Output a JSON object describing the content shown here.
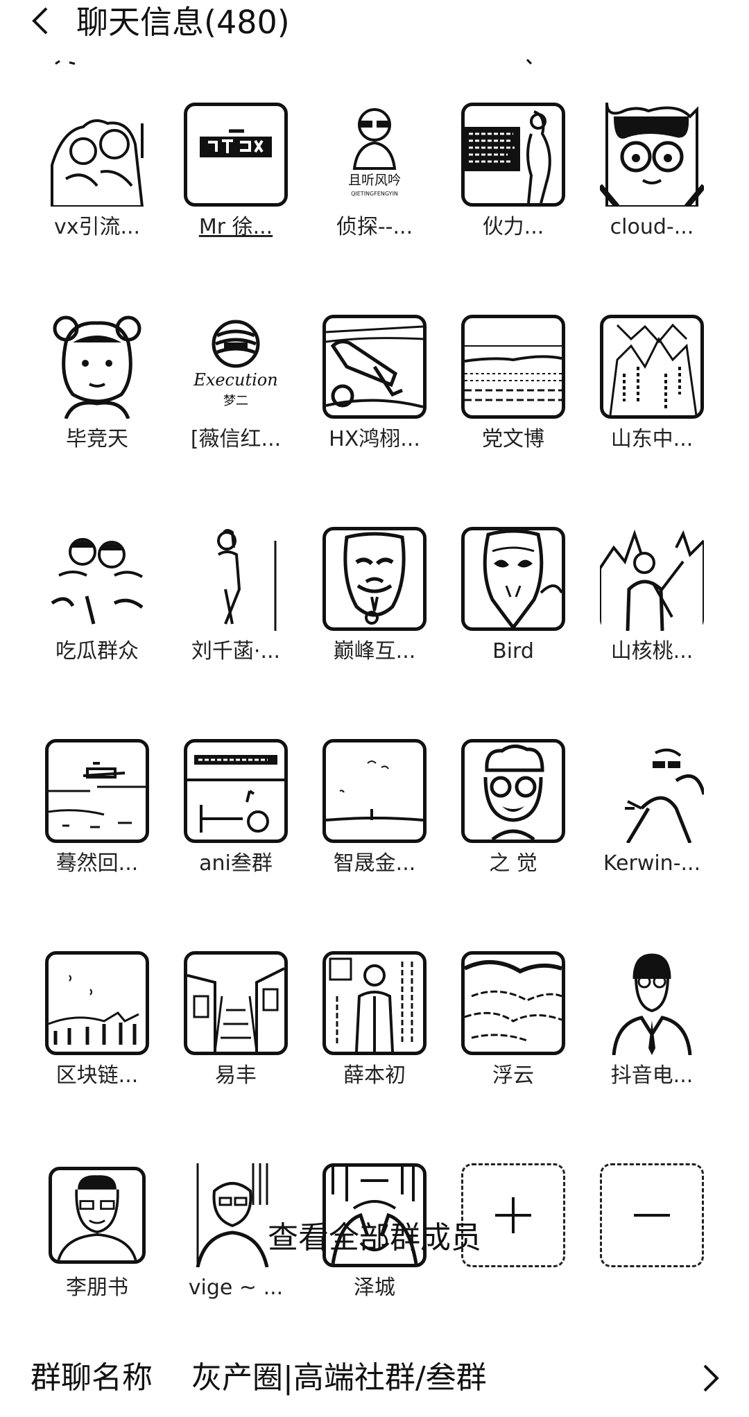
{
  "header": {
    "title": "聊天信息(480)"
  },
  "members": [
    {
      "name": "vx引流..."
    },
    {
      "name": "Mr 徐..."
    },
    {
      "name": "侦探--..."
    },
    {
      "name": "伙力..."
    },
    {
      "name": "cloud-..."
    },
    {
      "name": "毕竞天"
    },
    {
      "name": "[薇信红..."
    },
    {
      "name": "HX鸿栩..."
    },
    {
      "name": "党文博"
    },
    {
      "name": "山东中..."
    },
    {
      "name": "吃瓜群众"
    },
    {
      "name": "刘千菡·..."
    },
    {
      "name": "巅峰互..."
    },
    {
      "name": "Bird"
    },
    {
      "name": "山核桃..."
    },
    {
      "name": "蓦然回..."
    },
    {
      "name": "ani叁群"
    },
    {
      "name": "智晟金..."
    },
    {
      "name": "之 觉"
    },
    {
      "name": "Kerwin-..."
    },
    {
      "name": "区块链..."
    },
    {
      "name": "易丰"
    },
    {
      "name": "薛本初"
    },
    {
      "name": "浮云"
    },
    {
      "name": "抖音电..."
    },
    {
      "name": "李朋书"
    },
    {
      "name": "vige ~ ..."
    },
    {
      "name": "泽城"
    }
  ],
  "avatar_logo_texts": {
    "m2": "且听风吟",
    "m2_sub": "QIETINGFENGYIN",
    "m6": "Execution",
    "m6_sub": "梦二"
  },
  "actions": {
    "add_icon": "plus-icon",
    "remove_icon": "minus-icon"
  },
  "view_all": "查看全部群成员",
  "group_name_row": {
    "label": "群聊名称",
    "value": "灰产圈|高端社群/叁群"
  }
}
